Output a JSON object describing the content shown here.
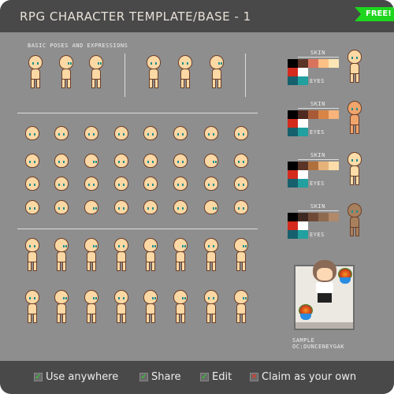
{
  "header": {
    "title": "RPG CHARACTER TEMPLATE/BASE - 1",
    "badge": "FREE!"
  },
  "sections": {
    "poses_label": "BASIC POSES AND EXPRESSIONS"
  },
  "palettes": [
    {
      "skin_label": "SKIN",
      "eyes_label": "EYES",
      "skin": [
        "#000000",
        "#5a3426",
        "#d9735e",
        "#fcbf84",
        "#fde6b5"
      ],
      "extra": [
        "#d42b1e",
        "#ffffff"
      ],
      "eyes": [
        "#16606e",
        "#22a0a0"
      ],
      "figure_skin": "#fcd8a4"
    },
    {
      "skin_label": "SKIN",
      "eyes_label": "EYES",
      "skin": [
        "#000000",
        "#4e2a20",
        "#a85a36",
        "#d88446",
        "#f7b37a"
      ],
      "extra": [
        "#d42b1e",
        "#ffffff"
      ],
      "eyes": [
        "#16606e",
        "#22a0a0"
      ],
      "figure_skin": "#f0a56c"
    },
    {
      "skin_label": "SKIN",
      "eyes_label": "EYES",
      "skin": [
        "#000000",
        "#5a3426",
        "#b0703e",
        "#e7b27a",
        "#fcdca8"
      ],
      "extra": [
        "#d42b1e",
        "#ffffff"
      ],
      "eyes": [
        "#16606e",
        "#22a0a0"
      ],
      "figure_skin": "#fcdca8"
    },
    {
      "skin_label": "SKIN",
      "eyes_label": "EYES",
      "skin": [
        "#000000",
        "#3e2a22",
        "#6e4a36",
        "#8e6a4e",
        "#b08a6a"
      ],
      "extra": [
        "#d42b1e",
        "#ffffff"
      ],
      "eyes": [
        "#16606e",
        "#22a0a0"
      ],
      "figure_skin": "#a8805e"
    }
  ],
  "sample": {
    "label": "SAMPLE",
    "credit": "OC:DUNCENEYGAK"
  },
  "footer": {
    "permissions": [
      {
        "label": "Use anywhere",
        "allowed": true
      },
      {
        "label": "Share",
        "allowed": true
      },
      {
        "label": "Edit",
        "allowed": true
      },
      {
        "label": "Claim as your own",
        "allowed": false
      }
    ]
  },
  "colors": {
    "allowed": "#22dd22",
    "denied": "#ee3322",
    "skin": "#fcd8a4",
    "outline": "#6b3f2a"
  }
}
